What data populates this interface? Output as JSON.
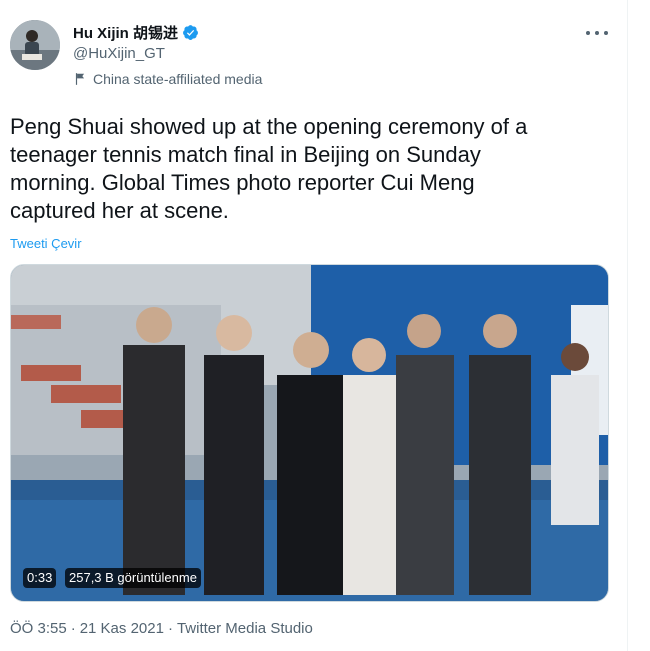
{
  "tweet": {
    "author_name": "Hu Xijin 胡锡进",
    "author_handle": "@HuXijin_GT",
    "affiliation": "China state-affiliated media",
    "text": "Peng Shuai showed up at the opening ceremony of a\nteenager tennis match final in Beijing on Sunday\nmorning. Global Times photo reporter Cui Meng\ncaptured her at scene.",
    "translate_label": "Tweeti Çevir",
    "video": {
      "duration": "0:33",
      "views": "257,3 B görüntülenme"
    },
    "footer": {
      "time": "ÖÖ 3:55",
      "separator1": "·",
      "date": "21 Kas 2021",
      "separator2": "·",
      "source": "Twitter Media Studio"
    }
  },
  "icons": {
    "verified": "verified-badge-icon",
    "affiliation": "flag-icon",
    "more": "more-icon"
  },
  "colors": {
    "accent": "#1d9bf0",
    "text": "#0f1419",
    "muted": "#536471"
  }
}
